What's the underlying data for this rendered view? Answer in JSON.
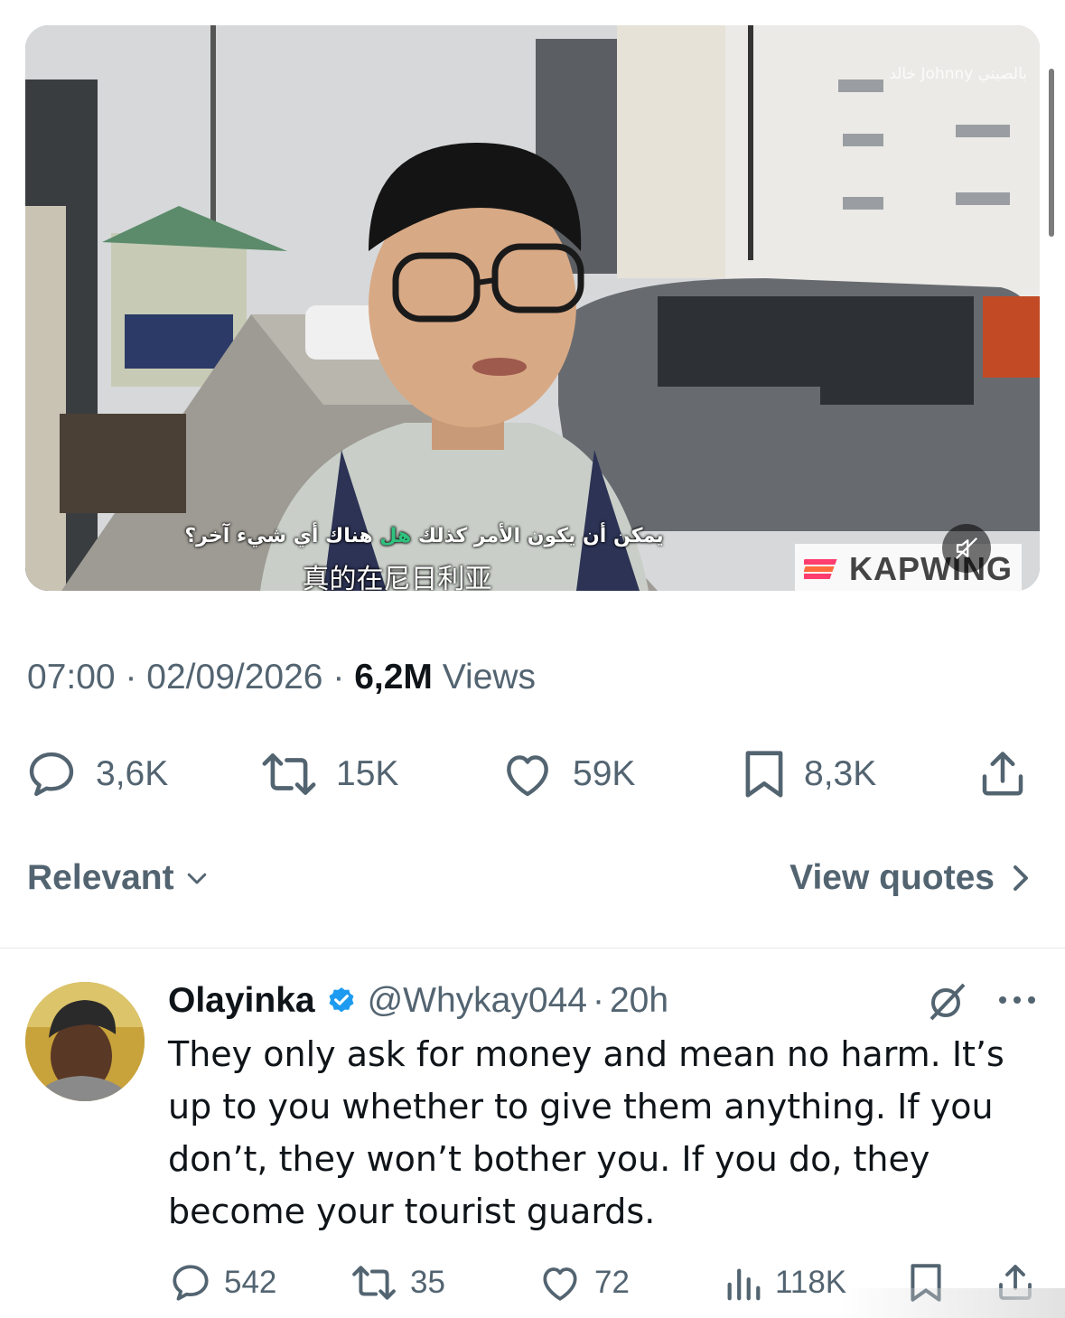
{
  "video": {
    "subtitle_arabic_prefix": "يمكن أن يكون الأمر كذلك ",
    "subtitle_arabic_highlight": "هل",
    "subtitle_arabic_suffix": " هناك أي شيء آخر؟",
    "subtitle_chinese": "真的在尼日利亚",
    "channel_tag": "ﺧﺎﻟﺪ Johnny ﺑﺎﻟﺼﻴﻨﻲ",
    "watermark": "KAPWING",
    "muted": true,
    "highlight_color": "#2ec27e"
  },
  "tweet_meta": {
    "time": "07:00",
    "separator": "·",
    "date": "02/09/2026",
    "views_count": "6,2M",
    "views_label": "Views"
  },
  "tweet_actions": {
    "replies": "3,6K",
    "reposts": "15K",
    "likes": "59K",
    "bookmarks": "8,3K"
  },
  "sort": {
    "label": "Relevant",
    "view_quotes": "View quotes"
  },
  "reply": {
    "name": "Olayinka",
    "handle": "@Whykay044",
    "separator": "·",
    "time": "20h",
    "text": "They only ask for money and mean no harm. It’s up to you whether to give them anything. If you don’t, they won’t bother you. If you do, they become your tourist guards.",
    "actions": {
      "replies": "542",
      "reposts": "35",
      "likes": "72",
      "views": "118K"
    }
  },
  "colors": {
    "text_primary": "#0f1419",
    "text_secondary": "#536471",
    "verified": "#1d9bf0",
    "divider": "#e5e8eb"
  },
  "icons": [
    "reply-icon",
    "repost-icon",
    "like-icon",
    "bookmark-icon",
    "share-icon",
    "chevron-down-icon",
    "chevron-right-icon",
    "verified-badge-icon",
    "grok-icon",
    "more-icon",
    "views-icon",
    "mute-icon"
  ]
}
